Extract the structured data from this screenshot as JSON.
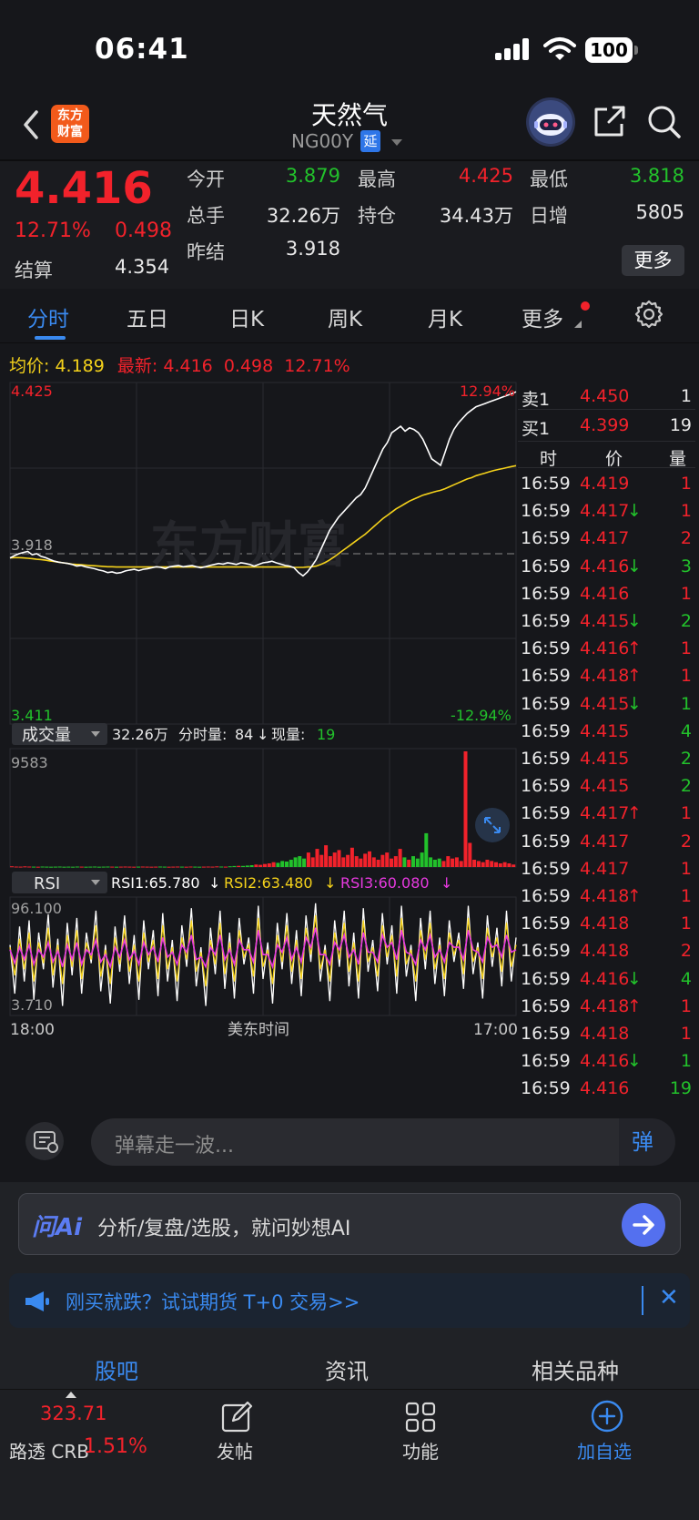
{
  "status_bar": {
    "time": "06:41",
    "battery": "100"
  },
  "header": {
    "logo_line1": "东方",
    "logo_line2": "财富",
    "title": "天然气",
    "code": "NG00Y",
    "delay_badge": "延"
  },
  "quote": {
    "last_price": "4.416",
    "change_pct": "12.71%",
    "change_abs": "0.498",
    "settle_label": "结算",
    "settle_value": "4.354",
    "open_label": "今开",
    "open_value": "3.879",
    "high_label": "最高",
    "high_value": "4.425",
    "low_label": "最低",
    "low_value": "3.818",
    "volume_label": "总手",
    "volume_value": "32.26万",
    "oi_label": "持仓",
    "oi_value": "34.43万",
    "daily_inc_label": "日增",
    "daily_inc_value": "5805",
    "prev_settle_label": "昨结",
    "prev_settle_value": "3.918",
    "more_label": "更多"
  },
  "tabs": [
    "分时",
    "五日",
    "日K",
    "周K",
    "月K",
    "更多"
  ],
  "active_tab": "分时",
  "info_line": {
    "avg_label": "均价:",
    "avg_value": "4.189",
    "latest_label": "最新:",
    "latest_value": "4.416",
    "latest_change": "0.498",
    "latest_pct": "12.71%"
  },
  "chart_data": [
    {
      "type": "line",
      "title": "",
      "series": [
        {
          "name": "最新",
          "color": "#ffffff",
          "values": [
            3.905,
            3.912,
            3.918,
            3.922,
            3.925,
            3.915,
            3.918,
            3.91,
            3.906,
            3.9,
            3.895,
            3.892,
            3.89,
            3.888,
            3.885,
            3.88,
            3.882,
            3.878,
            3.875,
            3.872,
            3.868,
            3.865,
            3.86,
            3.862,
            3.858,
            3.86,
            3.865,
            3.868,
            3.87,
            3.866,
            3.87,
            3.872,
            3.875,
            3.878,
            3.876,
            3.872,
            3.878,
            3.88,
            3.882,
            3.878,
            3.88,
            3.882,
            3.878,
            3.875,
            3.878,
            3.882,
            3.885,
            3.888,
            3.886,
            3.89,
            3.888,
            3.885,
            3.89,
            3.888,
            3.885,
            3.88,
            3.885,
            3.89,
            3.892,
            3.895,
            3.89,
            3.886,
            3.882,
            3.88,
            3.875,
            3.86,
            3.85,
            3.862,
            3.88,
            3.9,
            3.93,
            3.96,
            3.99,
            4.01,
            4.03,
            4.045,
            4.06,
            4.075,
            4.09,
            4.1,
            4.12,
            4.15,
            4.18,
            4.21,
            4.24,
            4.26,
            4.29,
            4.3,
            4.31,
            4.295,
            4.305,
            4.3,
            4.29,
            4.27,
            4.24,
            4.21,
            4.2,
            4.19,
            4.23,
            4.27,
            4.3,
            4.32,
            4.335,
            4.35,
            4.36,
            4.37,
            4.375,
            4.38,
            4.385,
            4.39,
            4.395,
            4.4,
            4.405,
            4.41,
            4.416
          ]
        },
        {
          "name": "均价",
          "color": "#f5d21b",
          "values": [
            3.905,
            3.906,
            3.906,
            3.905,
            3.904,
            3.903,
            3.901,
            3.9,
            3.898,
            3.896,
            3.894,
            3.892,
            3.89,
            3.888,
            3.886,
            3.885,
            3.884,
            3.883,
            3.882,
            3.881,
            3.88,
            3.879,
            3.878,
            3.878,
            3.877,
            3.877,
            3.877,
            3.877,
            3.877,
            3.877,
            3.877,
            3.877,
            3.877,
            3.877,
            3.877,
            3.877,
            3.877,
            3.877,
            3.877,
            3.877,
            3.877,
            3.877,
            3.877,
            3.877,
            3.877,
            3.877,
            3.877,
            3.877,
            3.877,
            3.877,
            3.877,
            3.877,
            3.877,
            3.877,
            3.877,
            3.877,
            3.877,
            3.877,
            3.877,
            3.877,
            3.877,
            3.877,
            3.877,
            3.877,
            3.876,
            3.876,
            3.876,
            3.877,
            3.878,
            3.88,
            3.885,
            3.891,
            3.899,
            3.908,
            3.918,
            3.928,
            3.938,
            3.948,
            3.958,
            3.968,
            3.978,
            3.99,
            4.002,
            4.014,
            4.026,
            4.036,
            4.046,
            4.056,
            4.064,
            4.072,
            4.08,
            4.086,
            4.092,
            4.098,
            4.102,
            4.106,
            4.11,
            4.113,
            4.118,
            4.124,
            4.13,
            4.136,
            4.142,
            4.148,
            4.152,
            4.158,
            4.162,
            4.166,
            4.17,
            4.174,
            4.177,
            4.18,
            4.183,
            4.186,
            4.189
          ]
        }
      ],
      "ylim": [
        3.411,
        4.425
      ],
      "prev_settle": 3.918,
      "y_top_label": "4.425",
      "y_bottom_label": "3.411",
      "y_mid_label": "3.918",
      "pct_top_label": "12.94%",
      "pct_bottom_label": "-12.94%",
      "grid": true
    },
    {
      "type": "bar",
      "indicator_label": "成交量",
      "total_volume": "32.26万",
      "minute_vol_label": "分时量:",
      "minute_vol_value": "84",
      "current_vol_label": "现量:",
      "current_vol_value": "19",
      "y_top_label": "9583",
      "ylim": [
        0,
        9583
      ],
      "values": [
        60,
        40,
        30,
        50,
        40,
        30,
        20,
        40,
        30,
        20,
        30,
        40,
        20,
        30,
        20,
        40,
        30,
        20,
        30,
        40,
        20,
        30,
        40,
        30,
        20,
        30,
        40,
        30,
        20,
        30,
        40,
        30,
        20,
        30,
        40,
        30,
        20,
        30,
        40,
        30,
        20,
        40,
        30,
        20,
        30,
        40,
        30,
        50,
        40,
        30,
        60,
        80,
        100,
        90,
        120,
        150,
        200,
        180,
        250,
        300,
        400,
        350,
        500,
        450,
        600,
        800,
        900,
        700,
        1200,
        800,
        1500,
        1000,
        1800,
        900,
        1200,
        1400,
        800,
        1000,
        1600,
        900,
        700,
        1100,
        1300,
        800,
        600,
        1000,
        1200,
        700,
        900,
        1500,
        800,
        600,
        900,
        700,
        1200,
        2800,
        800,
        600,
        700,
        500,
        900,
        700,
        800,
        500,
        9583,
        2000,
        600,
        500,
        400,
        600,
        500,
        400,
        300,
        400,
        300,
        200
      ]
    },
    {
      "type": "line",
      "indicator_label": "RSI",
      "rsi1_label": "RSI1:65.780",
      "rsi2_label": "RSI2:63.480",
      "rsi3_label": "RSI3:60.080",
      "y_top_label": "96.100",
      "y_bottom_label": "3.710",
      "ylim": [
        3.71,
        96.1
      ],
      "series": [
        {
          "name": "RSI1",
          "color": "#ffffff",
          "values": [
            60,
            20,
            75,
            30,
            80,
            15,
            70,
            40,
            85,
            25,
            65,
            10,
            78,
            35,
            82,
            20,
            70,
            45,
            88,
            22,
            60,
            12,
            75,
            38,
            84,
            28,
            68,
            15,
            80,
            40,
            72,
            18,
            86,
            30,
            64,
            14,
            76,
            42,
            90,
            26,
            58,
            10,
            74,
            36,
            88,
            24,
            70,
            16,
            82,
            44,
            66,
            20,
            92,
            32,
            62,
            12,
            78,
            40,
            86,
            28,
            72,
            18,
            84,
            46,
            94,
            30,
            60,
            14,
            80,
            42,
            88,
            26,
            70,
            16,
            90,
            38,
            64,
            22,
            86,
            44,
            76,
            20,
            92,
            34,
            60,
            14,
            82,
            40,
            88,
            28,
            66,
            18,
            80,
            46,
            70,
            24,
            92,
            36,
            62,
            16,
            84,
            42,
            74,
            26,
            88,
            30,
            66
          ]
        },
        {
          "name": "RSI2",
          "color": "#f5d21b",
          "values": [
            58,
            35,
            65,
            40,
            70,
            30,
            62,
            45,
            74,
            35,
            60,
            28,
            68,
            42,
            72,
            32,
            62,
            48,
            76,
            34,
            56,
            28,
            66,
            44,
            74,
            38,
            60,
            30,
            70,
            46,
            64,
            32,
            76,
            40,
            58,
            30,
            66,
            48,
            80,
            38,
            54,
            26,
            64,
            44,
            78,
            36,
            62,
            30,
            72,
            50,
            60,
            34,
            82,
            42,
            56,
            28,
            68,
            46,
            76,
            38,
            64,
            32,
            74,
            52,
            84,
            40,
            56,
            30,
            70,
            48,
            78,
            38,
            62,
            30,
            80,
            46,
            58,
            34,
            76,
            50,
            68,
            34,
            82,
            44,
            56,
            30,
            72,
            48,
            78,
            40,
            60,
            32,
            70,
            52,
            64,
            36,
            82,
            46,
            58,
            32,
            74,
            50,
            66,
            38,
            78,
            42,
            60
          ]
        },
        {
          "name": "RSI3",
          "color": "#e83ae0",
          "values": [
            56,
            45,
            58,
            48,
            60,
            44,
            56,
            50,
            62,
            46,
            55,
            42,
            60,
            48,
            62,
            44,
            56,
            52,
            64,
            46,
            52,
            42,
            58,
            50,
            64,
            48,
            55,
            44,
            62,
            52,
            58,
            46,
            66,
            50,
            54,
            44,
            60,
            54,
            68,
            48,
            50,
            42,
            58,
            52,
            68,
            48,
            56,
            44,
            64,
            56,
            56,
            46,
            72,
            52,
            52,
            42,
            60,
            54,
            66,
            48,
            58,
            46,
            66,
            58,
            74,
            52,
            52,
            44,
            62,
            56,
            68,
            50,
            56,
            44,
            70,
            54,
            54,
            46,
            68,
            58,
            62,
            48,
            72,
            54,
            52,
            44,
            64,
            56,
            68,
            50,
            56,
            46,
            62,
            58,
            58,
            48,
            72,
            56,
            54,
            46,
            66,
            58,
            60,
            50,
            68,
            54,
            56
          ]
        }
      ],
      "x_start_label": "18:00",
      "x_mid_label": "美东时间",
      "x_end_label": "17:00"
    }
  ],
  "order_book": {
    "ask_label": "卖1",
    "ask_price": "4.450",
    "ask_vol": "1",
    "bid_label": "买1",
    "bid_price": "4.399",
    "bid_vol": "19",
    "col_time": "时",
    "col_price": "价",
    "col_vol": "量"
  },
  "ticks": [
    {
      "t": "16:59",
      "p": "4.419",
      "a": "",
      "v": "1",
      "vc": "red"
    },
    {
      "t": "16:59",
      "p": "4.417",
      "a": "↓",
      "v": "1",
      "vc": "red"
    },
    {
      "t": "16:59",
      "p": "4.417",
      "a": "",
      "v": "2",
      "vc": "red"
    },
    {
      "t": "16:59",
      "p": "4.416",
      "a": "↓",
      "v": "3",
      "vc": "green"
    },
    {
      "t": "16:59",
      "p": "4.416",
      "a": "",
      "v": "1",
      "vc": "red"
    },
    {
      "t": "16:59",
      "p": "4.415",
      "a": "↓",
      "v": "2",
      "vc": "green"
    },
    {
      "t": "16:59",
      "p": "4.416",
      "a": "↑",
      "v": "1",
      "vc": "red"
    },
    {
      "t": "16:59",
      "p": "4.418",
      "a": "↑",
      "v": "1",
      "vc": "red"
    },
    {
      "t": "16:59",
      "p": "4.415",
      "a": "↓",
      "v": "1",
      "vc": "green"
    },
    {
      "t": "16:59",
      "p": "4.415",
      "a": "",
      "v": "4",
      "vc": "green"
    },
    {
      "t": "16:59",
      "p": "4.415",
      "a": "",
      "v": "2",
      "vc": "green"
    },
    {
      "t": "16:59",
      "p": "4.415",
      "a": "",
      "v": "2",
      "vc": "green"
    },
    {
      "t": "16:59",
      "p": "4.417",
      "a": "↑",
      "v": "1",
      "vc": "red"
    },
    {
      "t": "16:59",
      "p": "4.417",
      "a": "",
      "v": "2",
      "vc": "red"
    },
    {
      "t": "16:59",
      "p": "4.417",
      "a": "",
      "v": "1",
      "vc": "red"
    },
    {
      "t": "16:59",
      "p": "4.418",
      "a": "↑",
      "v": "1",
      "vc": "red"
    },
    {
      "t": "16:59",
      "p": "4.418",
      "a": "",
      "v": "1",
      "vc": "red"
    },
    {
      "t": "16:59",
      "p": "4.418",
      "a": "",
      "v": "2",
      "vc": "red"
    },
    {
      "t": "16:59",
      "p": "4.416",
      "a": "↓",
      "v": "4",
      "vc": "green"
    },
    {
      "t": "16:59",
      "p": "4.418",
      "a": "↑",
      "v": "1",
      "vc": "red"
    },
    {
      "t": "16:59",
      "p": "4.418",
      "a": "",
      "v": "1",
      "vc": "red"
    },
    {
      "t": "16:59",
      "p": "4.416",
      "a": "↓",
      "v": "1",
      "vc": "green"
    },
    {
      "t": "16:59",
      "p": "4.416",
      "a": "",
      "v": "19",
      "vc": "green"
    }
  ],
  "chat": {
    "placeholder": "弹幕走一波...",
    "danmu_label": "弹"
  },
  "ai_bar": {
    "logo": "问Ai",
    "prompt": "分析/复盘/选股，就问妙想AI"
  },
  "promo": {
    "text": "刚买就跌？试试期货 T+0 交易>>",
    "close": "✕"
  },
  "sub_tabs": [
    "股吧",
    "资讯",
    "相关品种"
  ],
  "bottom_nav": {
    "crb_value": "323.71",
    "crb_label": "路透 CRB",
    "crb_pct": "1.51%",
    "post": "发帖",
    "functions": "功能",
    "add_watch": "加自选"
  },
  "colors": {
    "up": "#f2222b",
    "down": "#22c12b",
    "accent": "#3a8af0",
    "avg_line": "#f5d21b"
  }
}
